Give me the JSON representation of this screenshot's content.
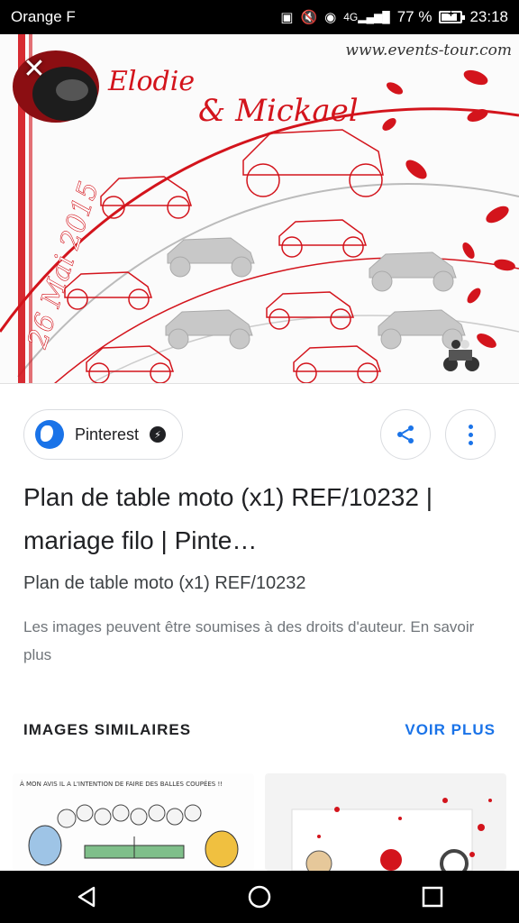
{
  "status_bar": {
    "carrier": "Orange F",
    "network": "4G",
    "battery": "77 %",
    "battery_level": 0.77,
    "time": "23:18",
    "icons": [
      "nfc-icon",
      "mute-icon",
      "eye-icon",
      "signal-icon",
      "battery-icon"
    ]
  },
  "hero": {
    "watermark": "www.events-tour.com",
    "names": "Elodie & Mickael",
    "date_text": "26 Mai 2015",
    "accent_color": "#d3141c"
  },
  "source": {
    "name": "Pinterest",
    "icon": "globe-icon",
    "badge_icon": "amp-lightning-icon"
  },
  "actions": {
    "share_icon": "share-icon",
    "more_icon": "more-vert-icon"
  },
  "result": {
    "title": "Plan de table moto (x1) REF/10232 | mariage filo | Pinte…",
    "subtitle": "Plan de table moto (x1) REF/10232",
    "copyright": "Les images peuvent être soumises à des droits d'auteur. En savoir plus"
  },
  "similar": {
    "heading": "IMAGES SIMILAIRES",
    "more": "VOIR PLUS",
    "thumb1_caption": "À MON AVIS IL A L'INTENTION DE FAIRE DES BALLES COUPÉES !!"
  },
  "nav": {
    "back": "back-icon",
    "home": "home-icon",
    "recents": "recents-icon"
  },
  "colors": {
    "link_blue": "#1a73e8",
    "text_dark": "#202124",
    "text_grey": "#70757a"
  }
}
